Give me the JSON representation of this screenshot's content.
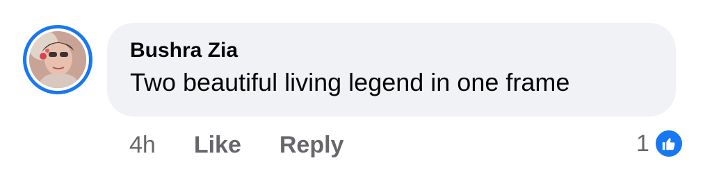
{
  "comment": {
    "author": "Bushra Zia",
    "text": "Two beautiful living legend in one frame",
    "time": "4h",
    "like_label": "Like",
    "reply_label": "Reply",
    "reaction_count": "1",
    "reaction_icon": "thumbs-up-icon"
  },
  "colors": {
    "accent": "#1877f2",
    "bubble_bg": "#f0f2f5",
    "text": "#050505",
    "meta_text": "#65676b"
  }
}
